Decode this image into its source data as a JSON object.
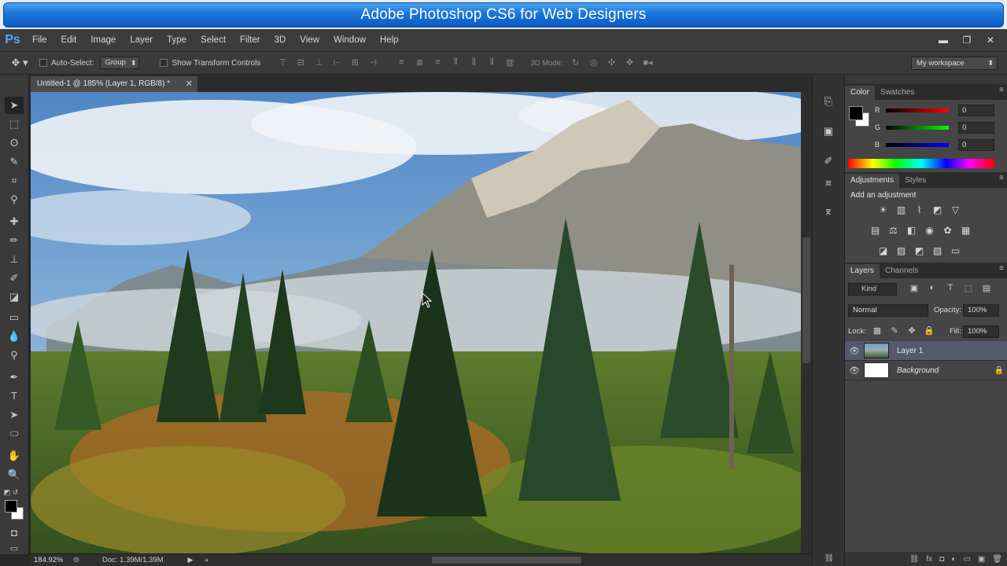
{
  "banner": {
    "title": "Adobe Photoshop CS6 for Web Designers"
  },
  "app": {
    "logo": "Ps"
  },
  "menu": [
    "File",
    "Edit",
    "Image",
    "Layer",
    "Type",
    "Select",
    "Filter",
    "3D",
    "View",
    "Window",
    "Help"
  ],
  "window_controls": {
    "minimize": "▬",
    "restore": "❐",
    "close": "✕"
  },
  "options": {
    "tool_icon": "move-tool-icon",
    "auto_select_label": "Auto-Select:",
    "auto_select_mode": "Group",
    "transform_label": "Show Transform Controls",
    "mode3d_label": "3D Mode:",
    "workspace": "My workspace"
  },
  "document": {
    "tab_title": "Untitled-1 @ 185% (Layer 1, RGB/8) *",
    "close_glyph": "✕"
  },
  "status": {
    "zoom": "184.92%",
    "doc_info": "Doc: 1.39M/1.39M"
  },
  "color_panel": {
    "tabs": [
      "Color",
      "Swatches"
    ],
    "r_label": "R",
    "r_value": "0",
    "g_label": "G",
    "g_value": "0",
    "b_label": "B",
    "b_value": "0",
    "foreground": "#000000",
    "background": "#ffffff"
  },
  "adjustments_panel": {
    "tabs": [
      "Adjustments",
      "Styles"
    ],
    "title": "Add an adjustment"
  },
  "layers_panel": {
    "tabs": [
      "Layers",
      "Channels"
    ],
    "filter_kind": "Kind",
    "blend_mode": "Normal",
    "opacity_label": "Opacity:",
    "opacity_value": "100%",
    "lock_label": "Lock:",
    "fill_label": "Fill:",
    "fill_value": "100%",
    "layers": [
      {
        "name": "Layer 1",
        "selected": true
      },
      {
        "name": "Background",
        "selected": false,
        "locked": true
      }
    ]
  },
  "colors": {
    "accent_blue": "#1a74d8",
    "panel_bg": "#383838",
    "selected_layer": "#545a6e"
  }
}
